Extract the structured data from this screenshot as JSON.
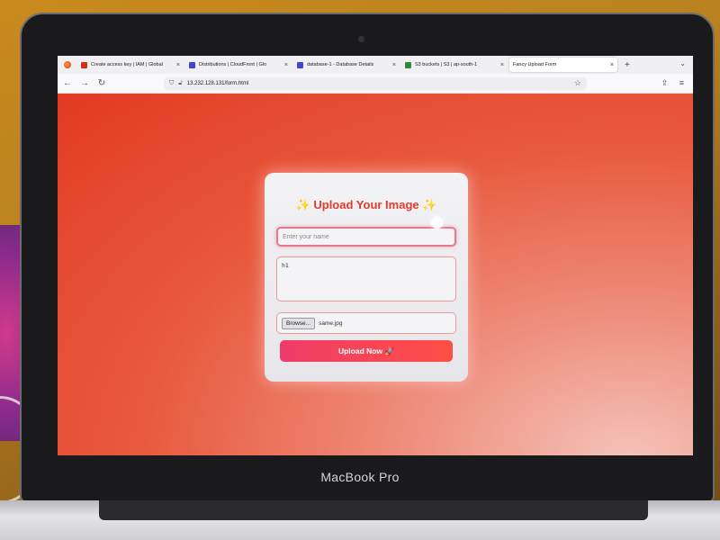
{
  "device": {
    "brand_label": "MacBook Pro"
  },
  "browser": {
    "tabs": [
      {
        "label": "Create access key | IAM | Global",
        "favicon_color": "#d13212"
      },
      {
        "label": "Distributions | CloudFront | Glo",
        "favicon_color": "#3f48cc"
      },
      {
        "label": "database-1 - Database Details",
        "favicon_color": "#3f48cc"
      },
      {
        "label": "S3 buckets | S3 | ap-south-1",
        "favicon_color": "#2e8b3a"
      },
      {
        "label": "Fancy Upload Form",
        "favicon_color": ""
      }
    ],
    "url": "13.232.128.131/form.html"
  },
  "form": {
    "title": "✨ Upload Your Image ✨",
    "name_placeholder": "Enter your name",
    "name_value": "",
    "description_value": "h1",
    "browse_label": "Browse...",
    "file_name": "same.jpg",
    "submit_label": "Upload Now 🚀"
  },
  "colors": {
    "title": "#e53a2c",
    "button_start": "#ef3b6a",
    "button_end": "#ff4f44",
    "page_background": "#e23a22"
  }
}
